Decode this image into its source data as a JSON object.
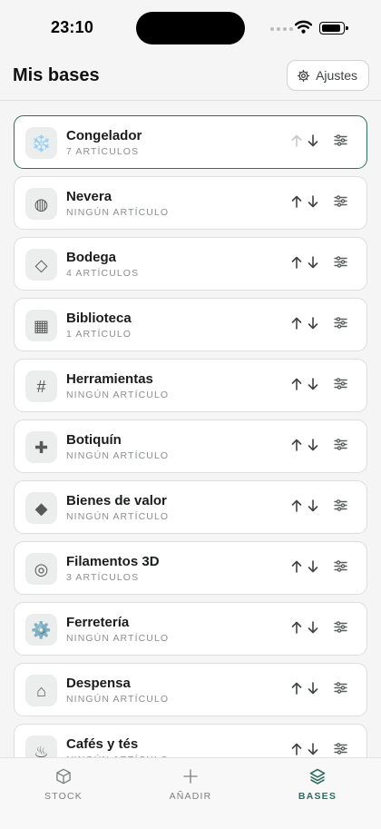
{
  "status": {
    "time": "23:10"
  },
  "header": {
    "title": "Mis bases",
    "settings_label": "Ajustes"
  },
  "bases": [
    {
      "name": "Congelador",
      "count": "7 ARTÍCULOS",
      "icon": "snowflake",
      "glyph": "❄️",
      "selected": true,
      "up_disabled": true
    },
    {
      "name": "Nevera",
      "count": "NINGÚN ARTÍCULO",
      "icon": "circle-grid",
      "glyph": "◍"
    },
    {
      "name": "Bodega",
      "count": "4 ARTÍCULOS",
      "icon": "diamond-outline",
      "glyph": "◇"
    },
    {
      "name": "Biblioteca",
      "count": "1 ARTÍCULO",
      "icon": "square",
      "glyph": "▦"
    },
    {
      "name": "Herramientas",
      "count": "NINGÚN ARTÍCULO",
      "icon": "hash",
      "glyph": "#"
    },
    {
      "name": "Botiquín",
      "count": "NINGÚN ARTÍCULO",
      "icon": "cross",
      "glyph": "✚"
    },
    {
      "name": "Bienes de valor",
      "count": "NINGÚN ARTÍCULO",
      "icon": "diamond-filled",
      "glyph": "◆"
    },
    {
      "name": "Filamentos 3D",
      "count": "3 ARTÍCULOS",
      "icon": "target",
      "glyph": "◎"
    },
    {
      "name": "Ferretería",
      "count": "NINGÚN ARTÍCULO",
      "icon": "gear",
      "glyph": "⚙️"
    },
    {
      "name": "Despensa",
      "count": "NINGÚN ARTÍCULO",
      "icon": "house",
      "glyph": "⌂"
    },
    {
      "name": "Cafés y tés",
      "count": "NINGÚN ARTÍCULO",
      "icon": "hot-springs",
      "glyph": "♨"
    }
  ],
  "tabs": [
    {
      "id": "stock",
      "label": "STOCK",
      "icon": "box-icon"
    },
    {
      "id": "add",
      "label": "AÑADIR",
      "icon": "plus-icon"
    },
    {
      "id": "bases",
      "label": "BASES",
      "icon": "layers-icon",
      "active": true
    }
  ],
  "colors": {
    "accent": "#2f6b5f",
    "background": "#f4f5f4",
    "card": "#ffffff"
  }
}
